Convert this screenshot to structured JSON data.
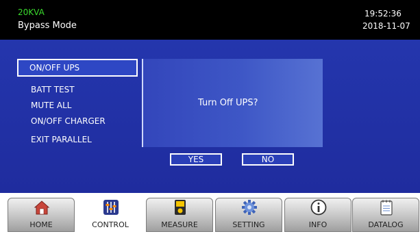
{
  "header": {
    "model": "20KVA",
    "mode": "Bypass Mode",
    "time": "19:52:36",
    "date": "2018-11-07"
  },
  "control_menu": {
    "items": [
      "ON/OFF UPS",
      "BATT TEST",
      "MUTE ALL",
      "ON/OFF CHARGER",
      "EXIT PARALLEL"
    ],
    "selected": "ON/OFF UPS"
  },
  "dialog": {
    "message": "Turn Off UPS?",
    "yes_label": "YES",
    "no_label": "NO"
  },
  "nav": {
    "tabs": [
      {
        "label": "HOME",
        "icon": "home-icon"
      },
      {
        "label": "CONTROL",
        "icon": "control-sliders-icon"
      },
      {
        "label": "MEASURE",
        "icon": "meter-icon"
      },
      {
        "label": "SETTING",
        "icon": "gear-icon"
      },
      {
        "label": "INFO",
        "icon": "info-icon"
      },
      {
        "label": "DATALOG",
        "icon": "notepad-icon"
      }
    ],
    "active": "CONTROL"
  },
  "colors": {
    "accent_green": "#3ad92d",
    "panel_blue": "#2436ad",
    "header_black": "#000000"
  }
}
